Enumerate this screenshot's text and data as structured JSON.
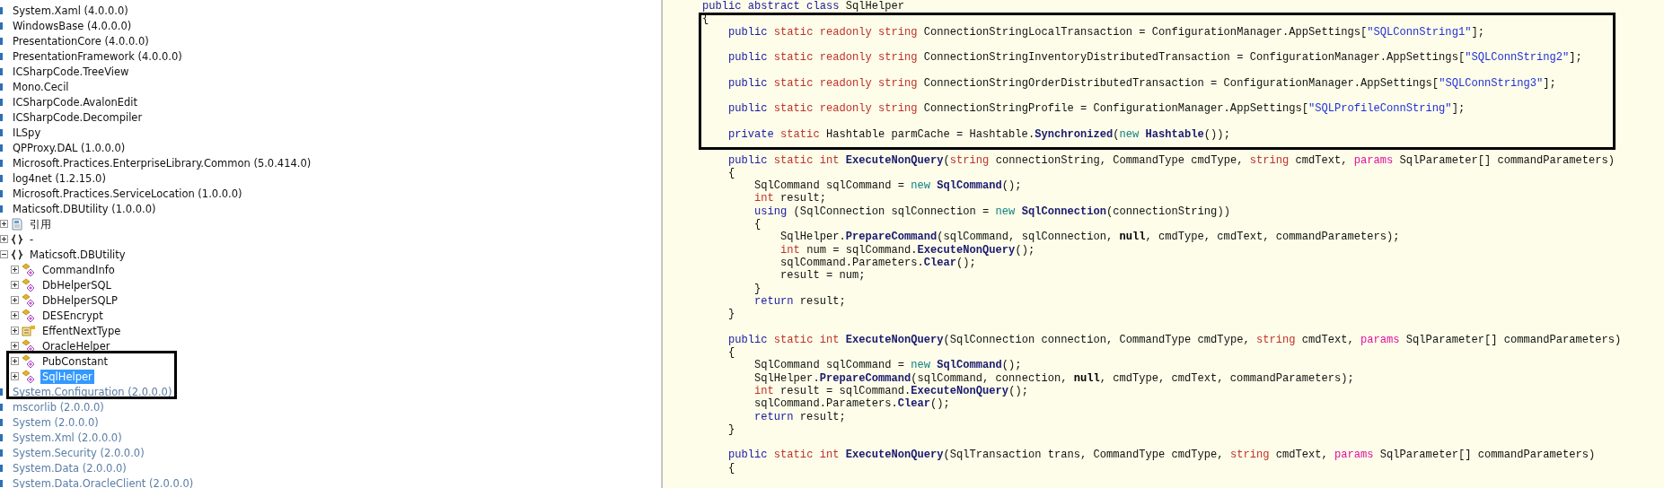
{
  "tree": {
    "items": [
      {
        "label": "System.Xaml (4.0.0.0)",
        "kind": "assembly",
        "dimmed": false,
        "selected": false
      },
      {
        "label": "WindowsBase (4.0.0.0)",
        "kind": "assembly",
        "dimmed": false,
        "selected": false
      },
      {
        "label": "PresentationCore (4.0.0.0)",
        "kind": "assembly",
        "dimmed": false,
        "selected": false
      },
      {
        "label": "PresentationFramework (4.0.0.0)",
        "kind": "assembly",
        "dimmed": false,
        "selected": false
      },
      {
        "label": "ICSharpCode.TreeView",
        "kind": "assembly",
        "dimmed": false,
        "selected": false
      },
      {
        "label": "Mono.Cecil",
        "kind": "assembly",
        "dimmed": false,
        "selected": false
      },
      {
        "label": "ICSharpCode.AvalonEdit",
        "kind": "assembly",
        "dimmed": false,
        "selected": false
      },
      {
        "label": "ICSharpCode.Decompiler",
        "kind": "assembly",
        "dimmed": false,
        "selected": false
      },
      {
        "label": "ILSpy",
        "kind": "assembly",
        "dimmed": false,
        "selected": false
      },
      {
        "label": "QPProxy.DAL (1.0.0.0)",
        "kind": "assembly",
        "dimmed": false,
        "selected": false
      },
      {
        "label": "Microsoft.Practices.EnterpriseLibrary.Common (5.0.414.0)",
        "kind": "assembly",
        "dimmed": false,
        "selected": false
      },
      {
        "label": "log4net (1.2.15.0)",
        "kind": "assembly",
        "dimmed": false,
        "selected": false
      },
      {
        "label": "Microsoft.Practices.ServiceLocation (1.0.0.0)",
        "kind": "assembly",
        "dimmed": false,
        "selected": false
      },
      {
        "label": "Maticsoft.DBUtility (1.0.0.0)",
        "kind": "assembly",
        "dimmed": false,
        "selected": false,
        "children": [
          {
            "label": "引用",
            "kind": "references",
            "expanded": false,
            "selected": false
          },
          {
            "label": "-",
            "kind": "namespace",
            "expanded": false,
            "selected": false
          },
          {
            "label": "Maticsoft.DBUtility",
            "kind": "namespace",
            "expanded": true,
            "selected": false,
            "children": [
              {
                "label": "CommandInfo",
                "kind": "class",
                "expanded": false,
                "selected": false
              },
              {
                "label": "DbHelperSQL",
                "kind": "class",
                "expanded": false,
                "selected": false
              },
              {
                "label": "DbHelperSQLP",
                "kind": "class",
                "expanded": false,
                "selected": false
              },
              {
                "label": "DESEncrypt",
                "kind": "class",
                "expanded": false,
                "selected": false
              },
              {
                "label": "EffentNextType",
                "kind": "enum",
                "expanded": false,
                "selected": false
              },
              {
                "label": "OracleHelper",
                "kind": "class",
                "expanded": false,
                "selected": false
              },
              {
                "label": "PubConstant",
                "kind": "class",
                "expanded": false,
                "selected": false
              },
              {
                "label": "SqlHelper",
                "kind": "class",
                "expanded": false,
                "selected": true
              }
            ]
          }
        ]
      },
      {
        "label": "System.Configuration (2.0.0.0)",
        "kind": "assembly",
        "dimmed": true,
        "selected": false
      },
      {
        "label": "mscorlib (2.0.0.0)",
        "kind": "assembly",
        "dimmed": true,
        "selected": false
      },
      {
        "label": "System (2.0.0.0)",
        "kind": "assembly",
        "dimmed": true,
        "selected": false
      },
      {
        "label": "System.Xml (2.0.0.0)",
        "kind": "assembly",
        "dimmed": true,
        "selected": false
      },
      {
        "label": "System.Security (2.0.0.0)",
        "kind": "assembly",
        "dimmed": true,
        "selected": false
      },
      {
        "label": "System.Data (2.0.0.0)",
        "kind": "assembly",
        "dimmed": true,
        "selected": false
      },
      {
        "label": "System.Data.OracleClient (2.0.0.0)",
        "kind": "assembly",
        "dimmed": true,
        "selected": false
      }
    ]
  },
  "code": {
    "lines": [
      {
        "blank_before": false,
        "tokens": [
          {
            "kind": "keyword",
            "text": "public abstract class"
          },
          {
            "kind": "plain",
            "text": " SqlHelper"
          }
        ]
      },
      {
        "blank_before": false,
        "tokens": [
          {
            "kind": "plain",
            "text": "{"
          }
        ]
      },
      {
        "blank_before": false,
        "tokens": [
          {
            "kind": "keyword",
            "text": "    public "
          },
          {
            "kind": "modifier",
            "text": "static readonly string"
          },
          {
            "kind": "plain",
            "text": " ConnectionStringLocalTransaction = ConfigurationManager.AppSettings["
          },
          {
            "kind": "string",
            "text": "\"SQLConnString1\""
          },
          {
            "kind": "plain",
            "text": "];"
          }
        ]
      },
      {
        "blank_before": true,
        "tokens": [
          {
            "kind": "keyword",
            "text": "    public "
          },
          {
            "kind": "modifier",
            "text": "static readonly string"
          },
          {
            "kind": "plain",
            "text": " ConnectionStringInventoryDistributedTransaction = ConfigurationManager.AppSettings["
          },
          {
            "kind": "string",
            "text": "\"SQLConnString2\""
          },
          {
            "kind": "plain",
            "text": "];"
          }
        ]
      },
      {
        "blank_before": true,
        "tokens": [
          {
            "kind": "keyword",
            "text": "    public "
          },
          {
            "kind": "modifier",
            "text": "static readonly string"
          },
          {
            "kind": "plain",
            "text": " ConnectionStringOrderDistributedTransaction = ConfigurationManager.AppSettings["
          },
          {
            "kind": "string",
            "text": "\"SQLConnString3\""
          },
          {
            "kind": "plain",
            "text": "];"
          }
        ]
      },
      {
        "blank_before": true,
        "tokens": [
          {
            "kind": "keyword",
            "text": "    public "
          },
          {
            "kind": "modifier",
            "text": "static readonly string"
          },
          {
            "kind": "plain",
            "text": " ConnectionStringProfile = ConfigurationManager.AppSettings["
          },
          {
            "kind": "string",
            "text": "\"SQLProfileConnString\""
          },
          {
            "kind": "plain",
            "text": "];"
          }
        ]
      },
      {
        "blank_before": true,
        "tokens": [
          {
            "kind": "keyword",
            "text": "    private "
          },
          {
            "kind": "modifier",
            "text": "static"
          },
          {
            "kind": "plain",
            "text": " Hashtable parmCache = Hashtable."
          },
          {
            "kind": "method",
            "text": "Synchronized"
          },
          {
            "kind": "plain",
            "text": "("
          },
          {
            "kind": "new",
            "text": "new "
          },
          {
            "kind": "method",
            "text": "Hashtable"
          },
          {
            "kind": "plain",
            "text": "());"
          }
        ]
      },
      {
        "blank_before": true,
        "tokens": [
          {
            "kind": "keyword",
            "text": "    public "
          },
          {
            "kind": "modifier",
            "text": "static int "
          },
          {
            "kind": "method",
            "text": "ExecuteNonQuery"
          },
          {
            "kind": "plain",
            "text": "("
          },
          {
            "kind": "modifier",
            "text": "string"
          },
          {
            "kind": "plain",
            "text": " connectionString, CommandType cmdType, "
          },
          {
            "kind": "modifier",
            "text": "string"
          },
          {
            "kind": "plain",
            "text": " cmdText, "
          },
          {
            "kind": "params",
            "text": "params"
          },
          {
            "kind": "plain",
            "text": " SqlParameter[] commandParameters)"
          }
        ]
      },
      {
        "blank_before": false,
        "tokens": [
          {
            "kind": "plain",
            "text": "    {"
          }
        ]
      },
      {
        "blank_before": false,
        "tokens": [
          {
            "kind": "plain",
            "text": "        SqlCommand sqlCommand = "
          },
          {
            "kind": "new",
            "text": "new "
          },
          {
            "kind": "method",
            "text": "SqlCommand"
          },
          {
            "kind": "plain",
            "text": "();"
          }
        ]
      },
      {
        "blank_before": false,
        "tokens": [
          {
            "kind": "modifier",
            "text": "        int"
          },
          {
            "kind": "plain",
            "text": " result;"
          }
        ]
      },
      {
        "blank_before": false,
        "tokens": [
          {
            "kind": "keyword",
            "text": "        using"
          },
          {
            "kind": "plain",
            "text": " (SqlConnection sqlConnection = "
          },
          {
            "kind": "new",
            "text": "new "
          },
          {
            "kind": "method",
            "text": "SqlConnection"
          },
          {
            "kind": "plain",
            "text": "(connectionString))"
          }
        ]
      },
      {
        "blank_before": false,
        "tokens": [
          {
            "kind": "plain",
            "text": "        {"
          }
        ]
      },
      {
        "blank_before": false,
        "tokens": [
          {
            "kind": "plain",
            "text": "            SqlHelper."
          },
          {
            "kind": "method",
            "text": "PrepareCommand"
          },
          {
            "kind": "plain",
            "text": "(sqlCommand, sqlConnection, "
          },
          {
            "kind": "null",
            "text": "null"
          },
          {
            "kind": "plain",
            "text": ", cmdType, cmdText, commandParameters);"
          }
        ]
      },
      {
        "blank_before": false,
        "tokens": [
          {
            "kind": "modifier",
            "text": "            int"
          },
          {
            "kind": "plain",
            "text": " num = sqlCommand."
          },
          {
            "kind": "method",
            "text": "ExecuteNonQuery"
          },
          {
            "kind": "plain",
            "text": "();"
          }
        ]
      },
      {
        "blank_before": false,
        "tokens": [
          {
            "kind": "plain",
            "text": "            sqlCommand.Parameters."
          },
          {
            "kind": "method",
            "text": "Clear"
          },
          {
            "kind": "plain",
            "text": "();"
          }
        ]
      },
      {
        "blank_before": false,
        "tokens": [
          {
            "kind": "plain",
            "text": "            result = num;"
          }
        ]
      },
      {
        "blank_before": false,
        "tokens": [
          {
            "kind": "plain",
            "text": "        }"
          }
        ]
      },
      {
        "blank_before": false,
        "tokens": [
          {
            "kind": "keyword",
            "text": "        return"
          },
          {
            "kind": "plain",
            "text": " result;"
          }
        ]
      },
      {
        "blank_before": false,
        "tokens": [
          {
            "kind": "plain",
            "text": "    }"
          }
        ]
      },
      {
        "blank_before": true,
        "tokens": [
          {
            "kind": "keyword",
            "text": "    public "
          },
          {
            "kind": "modifier",
            "text": "static int "
          },
          {
            "kind": "method",
            "text": "ExecuteNonQuery"
          },
          {
            "kind": "plain",
            "text": "(SqlConnection connection, CommandType cmdType, "
          },
          {
            "kind": "modifier",
            "text": "string"
          },
          {
            "kind": "plain",
            "text": " cmdText, "
          },
          {
            "kind": "params",
            "text": "params"
          },
          {
            "kind": "plain",
            "text": " SqlParameter[] commandParameters)"
          }
        ]
      },
      {
        "blank_before": false,
        "tokens": [
          {
            "kind": "plain",
            "text": "    {"
          }
        ]
      },
      {
        "blank_before": false,
        "tokens": [
          {
            "kind": "plain",
            "text": "        SqlCommand sqlCommand = "
          },
          {
            "kind": "new",
            "text": "new "
          },
          {
            "kind": "method",
            "text": "SqlCommand"
          },
          {
            "kind": "plain",
            "text": "();"
          }
        ]
      },
      {
        "blank_before": false,
        "tokens": [
          {
            "kind": "plain",
            "text": "        SqlHelper."
          },
          {
            "kind": "method",
            "text": "PrepareCommand"
          },
          {
            "kind": "plain",
            "text": "(sqlCommand, connection, "
          },
          {
            "kind": "null",
            "text": "null"
          },
          {
            "kind": "plain",
            "text": ", cmdType, cmdText, commandParameters);"
          }
        ]
      },
      {
        "blank_before": false,
        "tokens": [
          {
            "kind": "modifier",
            "text": "        int"
          },
          {
            "kind": "plain",
            "text": " result = sqlCommand."
          },
          {
            "kind": "method",
            "text": "ExecuteNonQuery"
          },
          {
            "kind": "plain",
            "text": "();"
          }
        ]
      },
      {
        "blank_before": false,
        "tokens": [
          {
            "kind": "plain",
            "text": "        sqlCommand.Parameters."
          },
          {
            "kind": "method",
            "text": "Clear"
          },
          {
            "kind": "plain",
            "text": "();"
          }
        ]
      },
      {
        "blank_before": false,
        "tokens": [
          {
            "kind": "keyword",
            "text": "        return"
          },
          {
            "kind": "plain",
            "text": " result;"
          }
        ]
      },
      {
        "blank_before": false,
        "tokens": [
          {
            "kind": "plain",
            "text": "    }"
          }
        ]
      },
      {
        "blank_before": true,
        "tokens": [
          {
            "kind": "keyword",
            "text": "    public "
          },
          {
            "kind": "modifier",
            "text": "static int "
          },
          {
            "kind": "method",
            "text": "ExecuteNonQuery"
          },
          {
            "kind": "plain",
            "text": "(SqlTransaction trans, CommandType cmdType, "
          },
          {
            "kind": "modifier",
            "text": "string"
          },
          {
            "kind": "plain",
            "text": " cmdText, "
          },
          {
            "kind": "params",
            "text": "params"
          },
          {
            "kind": "plain",
            "text": " SqlParameter[] commandParameters)"
          }
        ]
      },
      {
        "blank_before": false,
        "tokens": [
          {
            "kind": "plain",
            "text": "    {"
          }
        ]
      }
    ]
  }
}
